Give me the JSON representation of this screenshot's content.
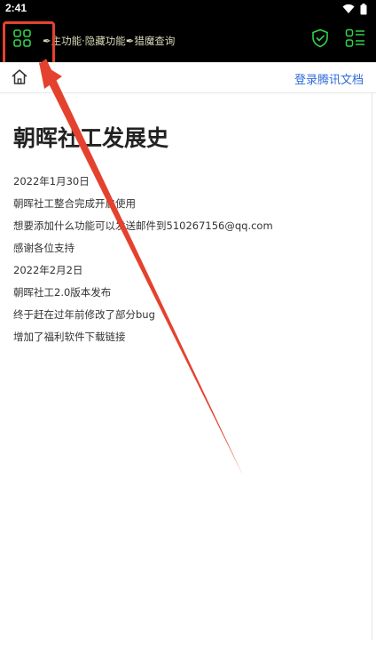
{
  "status_bar": {
    "time": "2:41"
  },
  "app_bar": {
    "marquee_text": "✒主功能·隐藏功能✒猎魔查询",
    "menu_icon": "grid-icon",
    "shield_icon": "shield-check-icon",
    "list_icon": "grid-list-icon",
    "icon_color": "#33d14a"
  },
  "nav": {
    "home_icon": "home-icon",
    "login_label": "登录腾讯文档"
  },
  "document": {
    "title": "朝晖社工发展史",
    "paragraphs": [
      "2022年1月30日",
      "朝晖社工整合完成开启使用",
      "想要添加什么功能可以发送邮件到510267156@qq.com",
      "感谢各位支持",
      "2022年2月2日",
      "朝晖社工2.0版本发布",
      "终于赶在过年前修改了部分bug",
      "增加了福利软件下载链接"
    ]
  },
  "annotation": {
    "color": "#e4422e"
  }
}
